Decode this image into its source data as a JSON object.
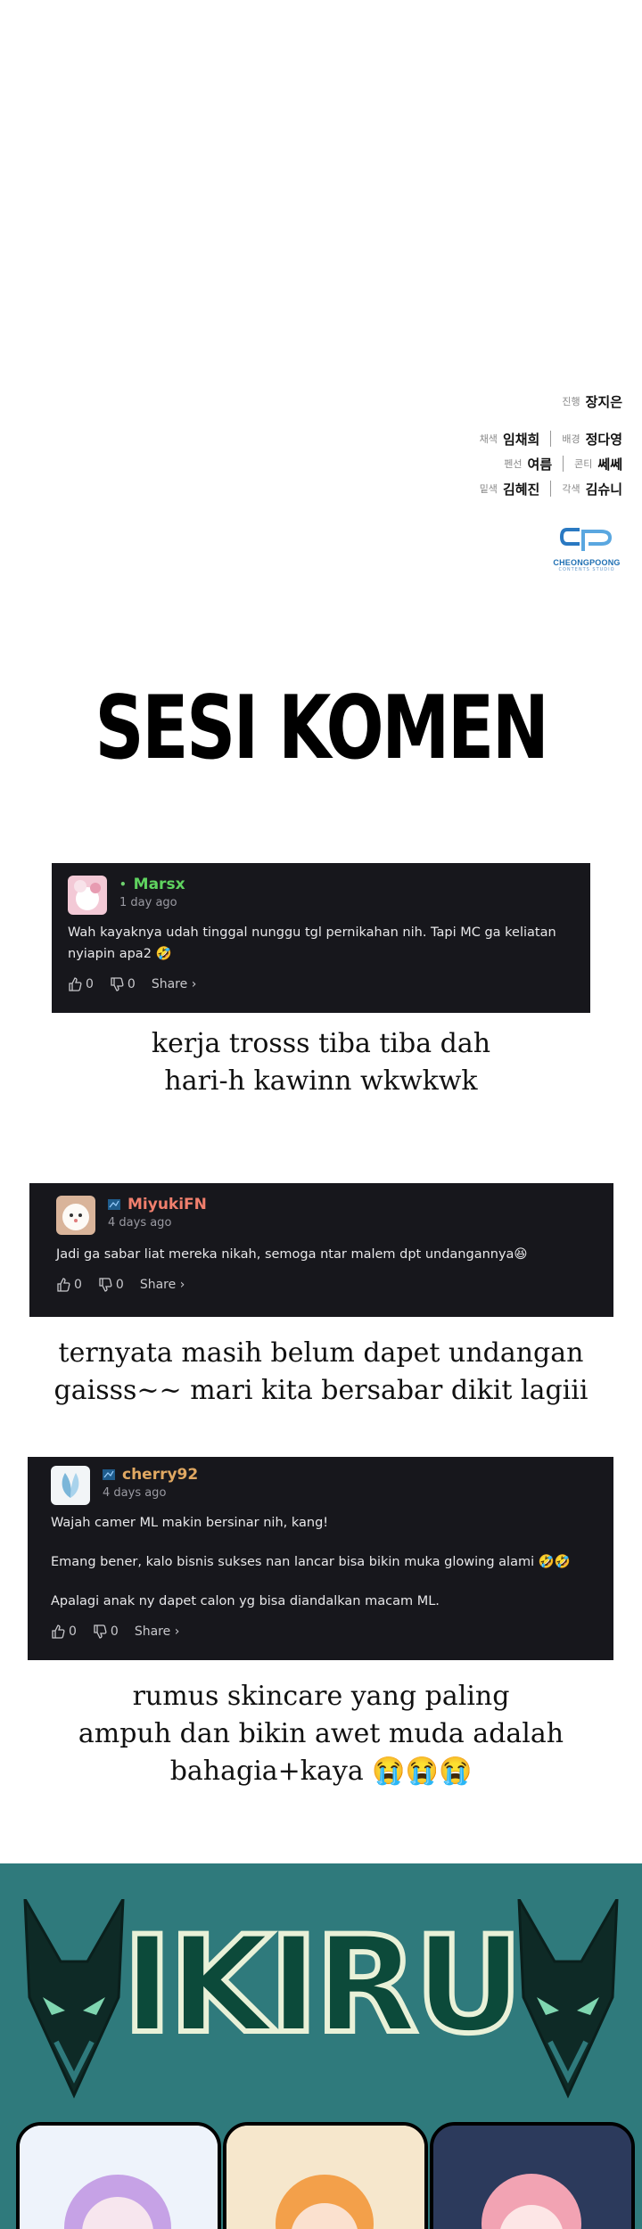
{
  "credits": {
    "lead": {
      "role": "진행",
      "name": "장지은"
    },
    "rows": [
      {
        "l_role": "채색",
        "l_name": "임채희",
        "r_role": "배경",
        "r_name": "정다영"
      },
      {
        "l_role": "펜선",
        "l_name": "여름",
        "r_role": "콘티",
        "r_name": "쎄쎄"
      },
      {
        "l_role": "밑색",
        "l_name": "김혜진",
        "r_role": "각색",
        "r_name": "김슈니"
      }
    ]
  },
  "logo": {
    "brand": "CHEONGPOONG",
    "sub": "CONTENTS STUDIO"
  },
  "title": "SESI KOMEN",
  "comments": [
    {
      "username": "Marsx",
      "name_color": "#5fd35f",
      "time": "1 day ago",
      "paragraphs": [
        "Wah kayaknya udah tinggal nunggu tgl pernikahan nih. Tapi MC ga keliatan nyiapin apa2 🤣"
      ],
      "likes": "0",
      "dislikes": "0",
      "share": "Share ›"
    },
    {
      "username": "MiyukiFN",
      "name_color": "#f07f6d",
      "time": "4 days ago",
      "paragraphs": [
        "Jadi ga sabar liat mereka nikah, semoga ntar malem dpt undangannya😆"
      ],
      "likes": "0",
      "dislikes": "0",
      "share": "Share ›"
    },
    {
      "username": "cherry92",
      "name_color": "#e0a862",
      "time": "4 days ago",
      "paragraphs": [
        "Wajah camer ML makin bersinar nih, kang!",
        "Emang bener, kalo bisnis sukses nan lancar bisa bikin muka glowing alami 🤣🤣",
        "Apalagi anak ny dapet calon yg bisa diandalkan macam ML."
      ],
      "likes": "0",
      "dislikes": "0",
      "share": "Share ›"
    }
  ],
  "captions": [
    [
      "kerja trosss tiba tiba dah",
      "hari-h kawinn wkwkwk"
    ],
    [
      "ternyata masih belum dapet undangan",
      "gaisss~~ mari kita bersabar dikit lagiii"
    ],
    [
      "rumus skincare yang paling",
      "ampuh dan bikin awet muda adalah",
      "bahagia+kaya 😭😭😭"
    ]
  ],
  "banner": {
    "title": "IKIRU",
    "bg_color": "#2f7a7c"
  }
}
